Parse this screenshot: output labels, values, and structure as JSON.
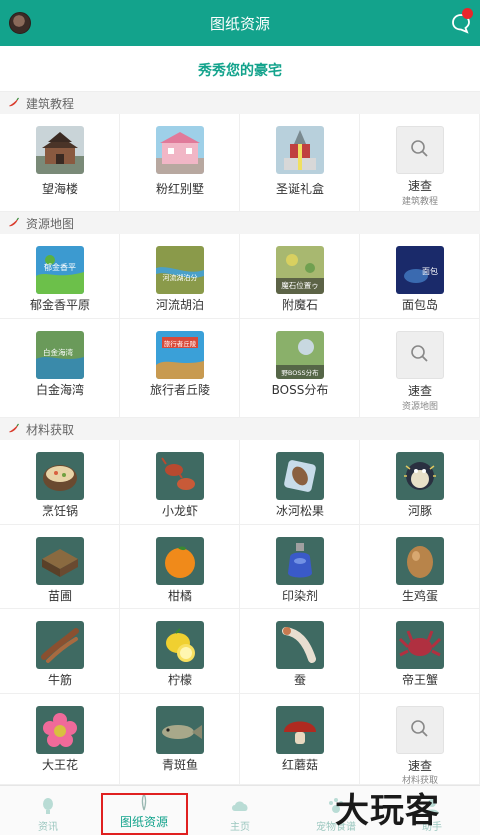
{
  "header": {
    "title": "图纸资源",
    "avatar": "user-avatar",
    "message_icon": "chat-icon",
    "notify_color": "#e8262b",
    "brand_color": "#13a38c"
  },
  "banner": {
    "text": "秀秀您的豪宅"
  },
  "sections": [
    {
      "label": "建筑教程",
      "items": [
        {
          "label": "望海楼",
          "thumb": "pavilion-image"
        },
        {
          "label": "粉红别墅",
          "thumb": "pink-villa-image"
        },
        {
          "label": "圣诞礼盒",
          "thumb": "christmas-box-image"
        },
        {
          "label": "速查",
          "sub": "建筑教程",
          "thumb": "search-icon"
        }
      ]
    },
    {
      "label": "资源地图",
      "items": [
        {
          "label": "郁金香平原",
          "thumb": "map-image",
          "caption": "郁金香平"
        },
        {
          "label": "河流胡泊",
          "thumb": "map-image",
          "caption": "河流湖泊分"
        },
        {
          "label": "附魔石",
          "thumb": "map-image",
          "caption": "魔石位置ゥ"
        },
        {
          "label": "面包岛",
          "thumb": "map-image",
          "caption": "面包"
        },
        {
          "label": "白金海湾",
          "thumb": "map-image",
          "caption": "白金海湾"
        },
        {
          "label": "旅行者丘陵",
          "thumb": "map-image",
          "caption": "旅行者丘陵"
        },
        {
          "label": "BOSS分布",
          "thumb": "map-image",
          "caption": "野BOSS分布"
        },
        {
          "label": "速查",
          "sub": "资源地图",
          "thumb": "search-icon"
        }
      ]
    },
    {
      "label": "材料获取",
      "items": [
        {
          "label": "烹饪锅",
          "thumb": "cooking-pot-image"
        },
        {
          "label": "小龙虾",
          "thumb": "crayfish-image"
        },
        {
          "label": "冰河松果",
          "thumb": "pinecone-image"
        },
        {
          "label": "河豚",
          "thumb": "pufferfish-image"
        },
        {
          "label": "苗圃",
          "thumb": "nursery-image"
        },
        {
          "label": "柑橘",
          "thumb": "orange-image"
        },
        {
          "label": "印染剂",
          "thumb": "dye-bottle-image"
        },
        {
          "label": "生鸡蛋",
          "thumb": "egg-image"
        },
        {
          "label": "牛筋",
          "thumb": "tendon-image"
        },
        {
          "label": "柠檬",
          "thumb": "lemon-image"
        },
        {
          "label": "蚕",
          "thumb": "silkworm-image"
        },
        {
          "label": "帝王蟹",
          "thumb": "king-crab-image"
        },
        {
          "label": "大王花",
          "thumb": "rafflesia-image"
        },
        {
          "label": "青斑鱼",
          "thumb": "grouper-image"
        },
        {
          "label": "红蘑菇",
          "thumb": "red-mushroom-image"
        },
        {
          "label": "速查",
          "sub": "材料获取",
          "thumb": "search-icon"
        }
      ]
    }
  ],
  "nav": [
    {
      "label": "资讯",
      "icon": "bulb-icon"
    },
    {
      "label": "图纸资源",
      "icon": "tower-icon",
      "active": true
    },
    {
      "label": "主页",
      "icon": "cloud-icon"
    },
    {
      "label": "宠物食谱",
      "icon": "paw-icon"
    },
    {
      "label": "助手",
      "icon": "user-icon"
    }
  ],
  "watermark": "大玩客"
}
